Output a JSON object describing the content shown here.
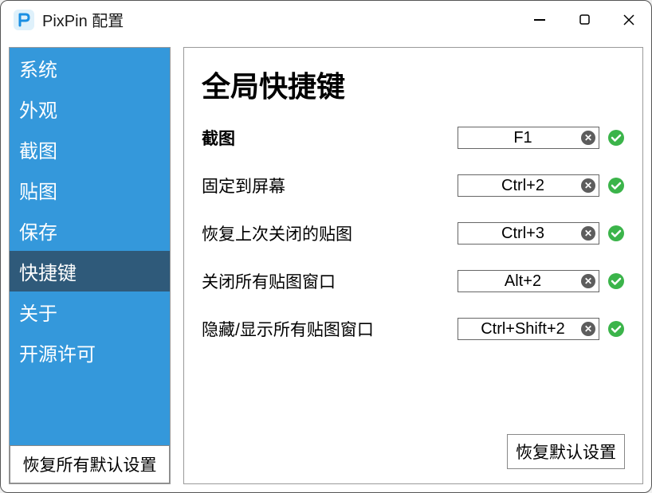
{
  "window": {
    "title": "PixPin 配置"
  },
  "sidebar": {
    "items": [
      {
        "label": "系统",
        "selected": false
      },
      {
        "label": "外观",
        "selected": false
      },
      {
        "label": "截图",
        "selected": false
      },
      {
        "label": "贴图",
        "selected": false
      },
      {
        "label": "保存",
        "selected": false
      },
      {
        "label": "快捷键",
        "selected": true
      },
      {
        "label": "关于",
        "selected": false
      },
      {
        "label": "开源许可",
        "selected": false
      }
    ],
    "restore_all": "恢复所有默认设置"
  },
  "main": {
    "title": "全局快捷键",
    "rows": [
      {
        "label": "截图",
        "value": "F1",
        "bold": true
      },
      {
        "label": "固定到屏幕",
        "value": "Ctrl+2",
        "bold": false
      },
      {
        "label": "恢复上次关闭的贴图",
        "value": "Ctrl+3",
        "bold": false
      },
      {
        "label": "关闭所有贴图窗口",
        "value": "Alt+2",
        "bold": false
      },
      {
        "label": "隐藏/显示所有贴图窗口",
        "value": "Ctrl+Shift+2",
        "bold": false
      }
    ],
    "restore_defaults": "恢复默认设置"
  }
}
